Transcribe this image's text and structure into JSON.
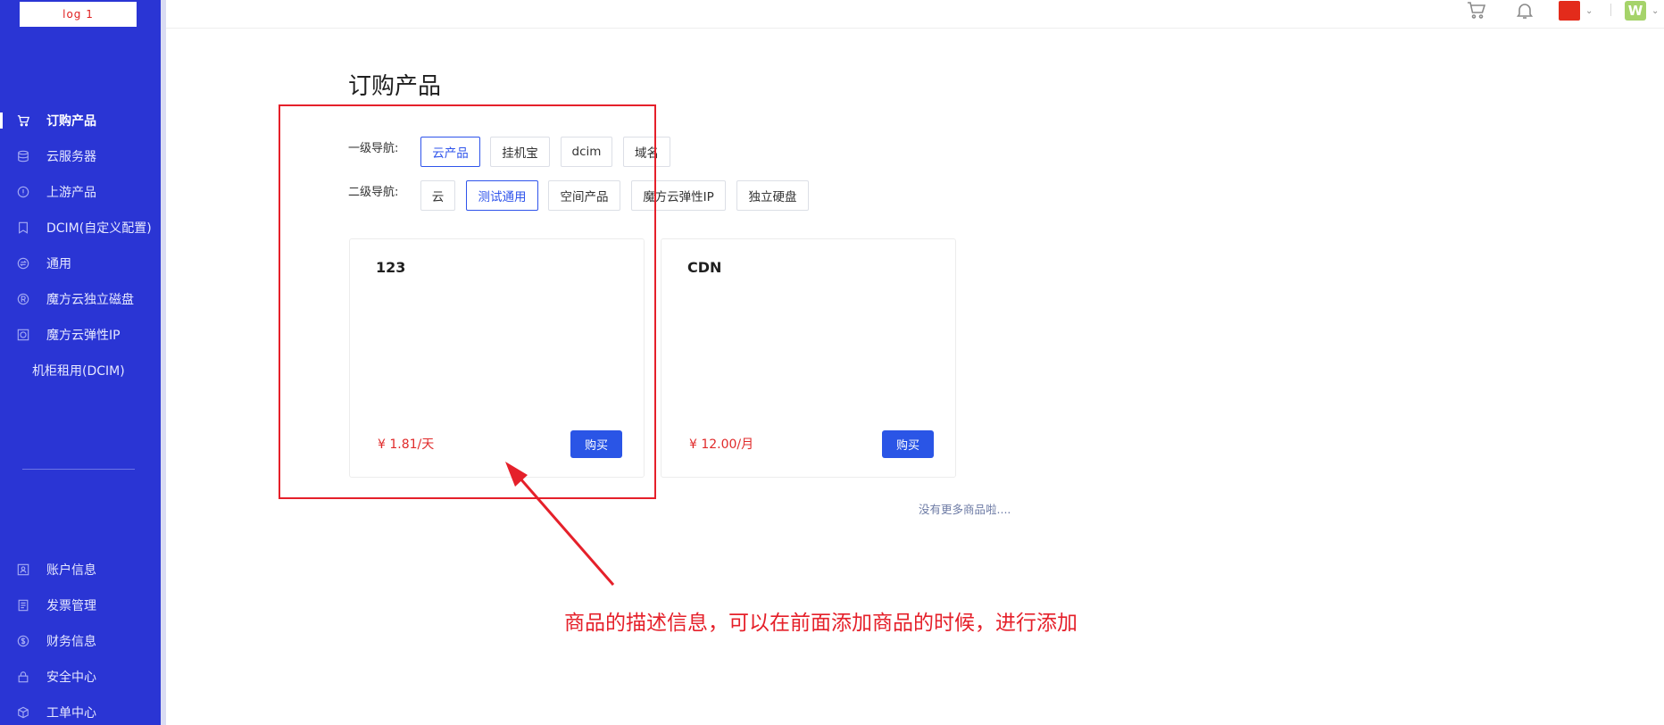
{
  "sidebar": {
    "logo_text": "log 1",
    "items": [
      {
        "label": "订购产品",
        "icon": "cart-icon",
        "active": true
      },
      {
        "label": "云服务器",
        "icon": "database-icon"
      },
      {
        "label": "上游产品",
        "icon": "info-circle-icon"
      },
      {
        "label": "DCIM(自定义配置)",
        "icon": "bookmark-icon"
      },
      {
        "label": "通用",
        "icon": "circle-swap-icon"
      },
      {
        "label": "魔方云独立磁盘",
        "icon": "registered-circle-icon"
      },
      {
        "label": "魔方云弹性IP",
        "icon": "picture-frame-icon"
      },
      {
        "label": "机柜租用(DCIM)",
        "icon": ""
      }
    ],
    "bottom_items": [
      {
        "label": "账户信息",
        "icon": "id-card-icon"
      },
      {
        "label": "发票管理",
        "icon": "invoice-icon"
      },
      {
        "label": "财务信息",
        "icon": "money-circle-icon"
      },
      {
        "label": "安全中心",
        "icon": "lock-icon"
      },
      {
        "label": "工单中心",
        "icon": "cube-icon"
      }
    ]
  },
  "header": {
    "cart_icon": "cart-icon",
    "bell_icon": "bell-icon",
    "flag_icon": "china-flag-icon",
    "avatar_letter": "W",
    "caret": "⌄"
  },
  "main": {
    "title": "订购产品",
    "level1_label": "一级导航:",
    "level1": [
      "云产品",
      "挂机宝",
      "dcim",
      "域名"
    ],
    "level1_selected": 0,
    "level2_label": "二级导航:",
    "level2": [
      "云",
      "测试通用",
      "空间产品",
      "魔方云弹性IP",
      "独立硬盘"
    ],
    "level2_selected": 1,
    "products": [
      {
        "name": "123",
        "price": "¥ 1.81/天",
        "buy": "购买"
      },
      {
        "name": "CDN",
        "price": "¥ 12.00/月",
        "buy": "购买"
      }
    ],
    "no_more": "没有更多商品啦...."
  },
  "annotation": {
    "text": "商品的描述信息，可以在前面添加商品的时候，进行添加",
    "color": "#e5202a"
  },
  "colors": {
    "sidebar_bg": "#2a35d4",
    "accent": "#2f54eb",
    "price": "#e02a2a",
    "buy_button": "#2a55e6"
  }
}
